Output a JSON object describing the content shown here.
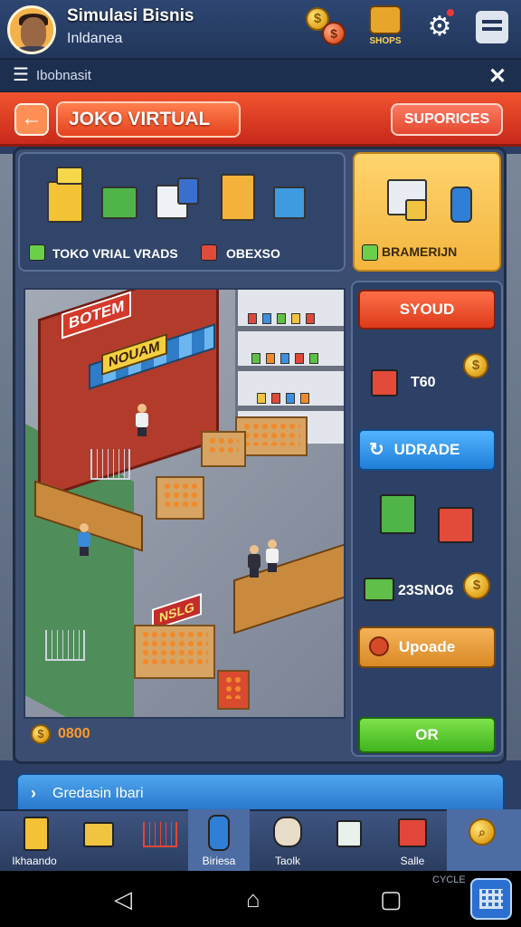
{
  "header": {
    "title": "Simulasi Bisnis",
    "subtitle": "Inldanea",
    "store_badge_label": "SHOPS",
    "coin_icon": "coin-icon",
    "coin_icon2": "coin-red-icon",
    "settings_icon": "gear-icon",
    "store_icon": "store-icon"
  },
  "secondary_bar": {
    "label": "Ibobnasit",
    "menu_icon": "menu-icon",
    "close_icon": "close-icon"
  },
  "titlebar": {
    "back_icon": "back-arrow-icon",
    "shop_name": "JOKO VIRTUAL",
    "supplies_label": "SUPORICES"
  },
  "products_panel": {
    "label_1": "TOKO VRIAL VRADS",
    "label_2": "OBEXSO"
  },
  "stock_panel": {
    "label": "BRAMERIJN"
  },
  "scene": {
    "shop_sign": "BOTEM",
    "awning_sign": "NOUAM",
    "promo_sign": "NSLG"
  },
  "balance": {
    "value": "0800"
  },
  "actions": {
    "sell_label": "SYOUD",
    "stat_1": "T60",
    "upgrade_label": "UDRADE",
    "stat_2": "23SNO6",
    "upgrade2_label": "Upoade",
    "ok_label": "OR"
  },
  "promo_strip": {
    "label": "Gredasin Ibari"
  },
  "tabs": [
    {
      "label": "Ikhaando",
      "icon": "box-icon"
    },
    {
      "label": "",
      "icon": "crate-icon"
    },
    {
      "label": "",
      "icon": "cart-icon"
    },
    {
      "label": "Biriesa",
      "icon": "bottle-icon"
    },
    {
      "label": "Taolk",
      "icon": "dog-icon"
    },
    {
      "label": "",
      "icon": "jar-icon"
    },
    {
      "label": "Salle",
      "icon": "gift-icon"
    },
    {
      "label": "",
      "icon": "search-coin-icon"
    }
  ],
  "system_nav": {
    "back_icon": "triangle-back-icon",
    "home_icon": "home-icon",
    "recents_icon": "square-recents-icon",
    "corner_text": "CYCLE"
  },
  "colors": {
    "title_red": "#d8351e",
    "accent_blue": "#2a78cc",
    "accent_green": "#41b51e",
    "panel_navy": "#31456a",
    "stock_yellow": "#f3b53f"
  }
}
